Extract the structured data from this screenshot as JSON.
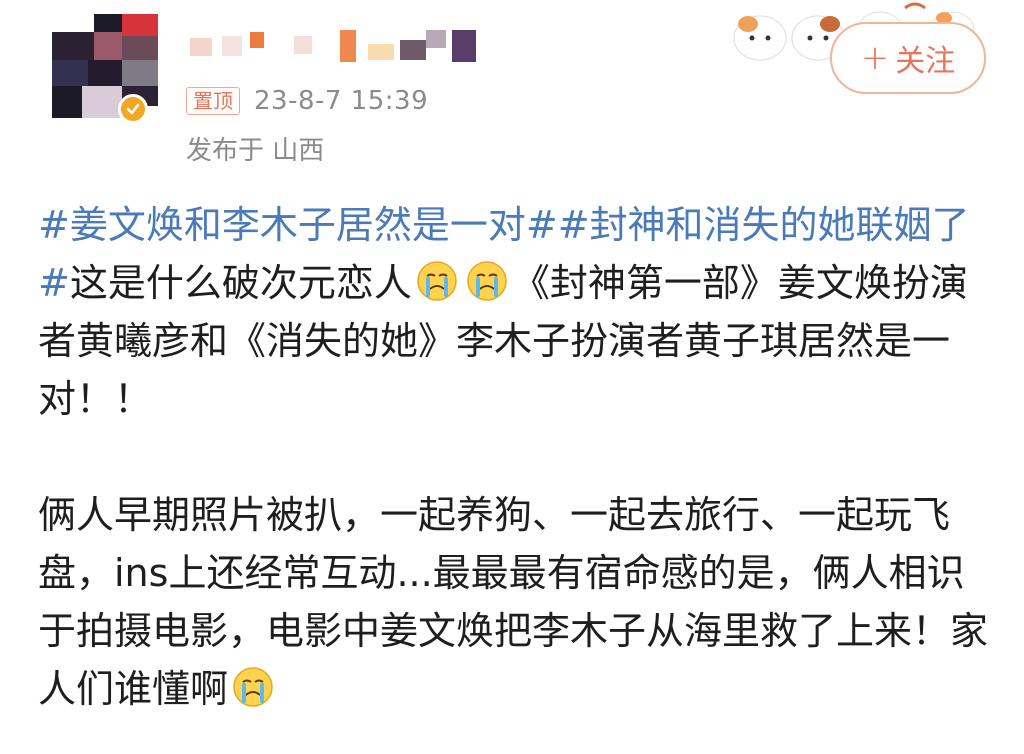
{
  "user": {
    "pin_label": "置顶",
    "timestamp": "23-8-7 15:39",
    "location": "发布于 山西"
  },
  "follow_button": {
    "plus": "+",
    "label": "关注"
  },
  "post": {
    "hashtag1": "#姜文焕和李木子居然是一对#",
    "hashtag2": "#封神和消失的她联姻了#",
    "text1": "这是什么破次元恋人",
    "text2": "《封神第一部》姜文焕扮演者黄曦彦和《消失的她》李木子扮演者黄子琪居然是一对！！",
    "text3": "俩人早期照片被扒，一起养狗、一起去旅行、一起玩飞盘，ins上还经常互动...最最最有宿命感的是，俩人相识于拍摄电影，电影中姜文焕把李木子从海里救了上来！家人们谁懂啊",
    "emoji": "crying-face-icon"
  }
}
